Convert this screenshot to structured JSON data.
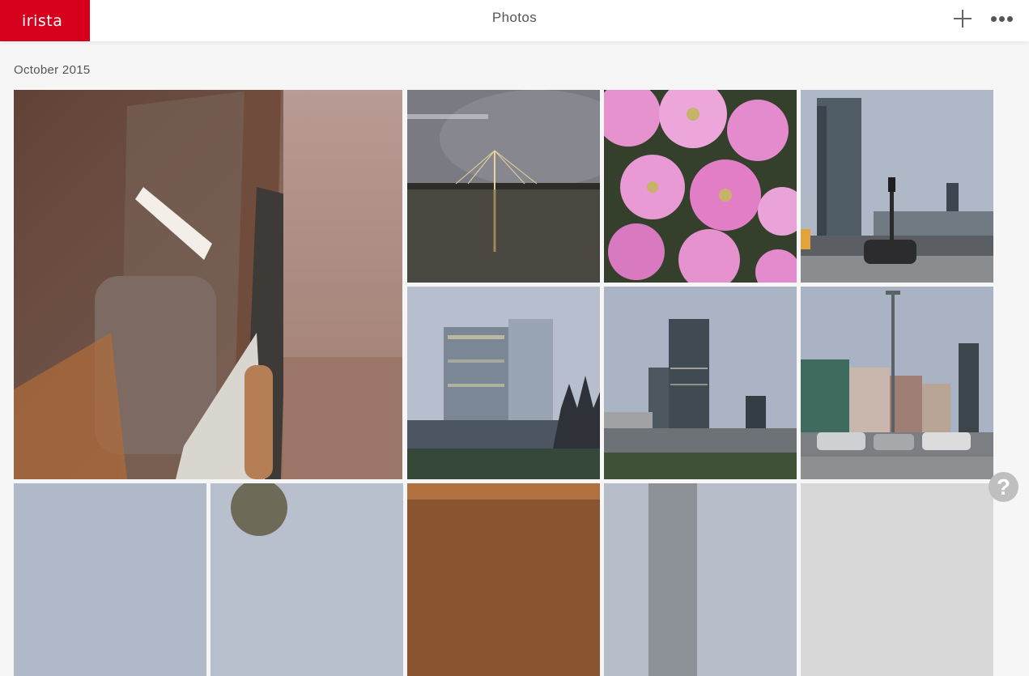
{
  "header": {
    "logo": "irista",
    "title": "Photos"
  },
  "section": {
    "title": "October 2015"
  },
  "help_label": "?",
  "photos": [
    {
      "subject": "train window interior"
    },
    {
      "subject": "bridge at night"
    },
    {
      "subject": "pink flowers"
    },
    {
      "subject": "skyscraper with traffic light"
    },
    {
      "subject": "glass tower"
    },
    {
      "subject": "twin skyscrapers"
    },
    {
      "subject": "street with parked cars"
    }
  ]
}
